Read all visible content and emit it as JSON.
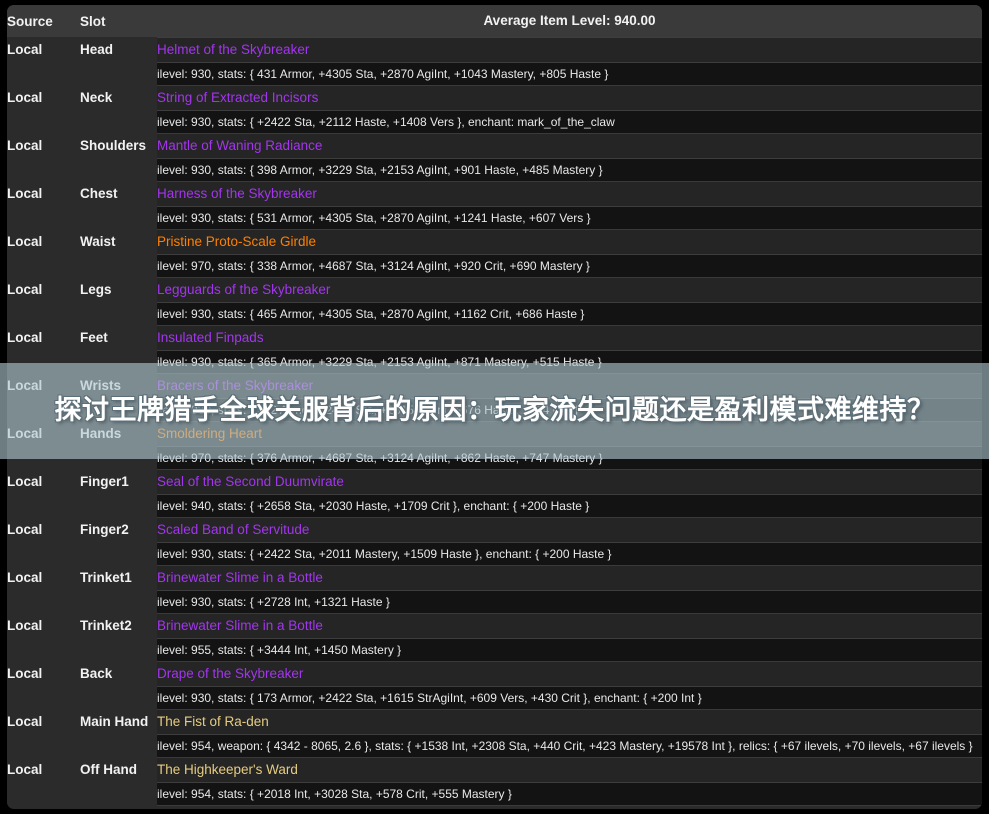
{
  "header": {
    "source_label": "Source",
    "slot_label": "Slot",
    "average_item_level": "Average Item Level: 940.00"
  },
  "colors": {
    "epic": "#a335ee",
    "legendary": "#ff8000",
    "artifact": "#e6cc80",
    "panel_bg": "#2b2b2b",
    "stat_bg": "#131313",
    "header_bg": "#3a3a3a",
    "overlay_bg": "rgba(176,200,208,0.62)"
  },
  "overlay": {
    "text": "探讨王牌猎手全球关服背后的原因：玩家流失问题还是盈利模式难维持？"
  },
  "rows": [
    {
      "source": "Local",
      "slot": "Head",
      "item": "Helmet of the Skybreaker",
      "quality": "epic",
      "stats": "ilevel: 930, stats: { 431 Armor, +4305 Sta, +2870 AgiInt, +1043 Mastery, +805 Haste }"
    },
    {
      "source": "Local",
      "slot": "Neck",
      "item": "String of Extracted Incisors",
      "quality": "epic",
      "stats": "ilevel: 930, stats: { +2422 Sta, +2112 Haste, +1408 Vers }, enchant: mark_of_the_claw"
    },
    {
      "source": "Local",
      "slot": "Shoulders",
      "item": "Mantle of Waning Radiance",
      "quality": "epic",
      "stats": "ilevel: 930, stats: { 398 Armor, +3229 Sta, +2153 AgiInt, +901 Haste, +485 Mastery }"
    },
    {
      "source": "Local",
      "slot": "Chest",
      "item": "Harness of the Skybreaker",
      "quality": "epic",
      "stats": "ilevel: 930, stats: { 531 Armor, +4305 Sta, +2870 AgiInt, +1241 Haste, +607 Vers }"
    },
    {
      "source": "Local",
      "slot": "Waist",
      "item": "Pristine Proto-Scale Girdle",
      "quality": "legendary",
      "stats": "ilevel: 970, stats: { 338 Armor, +4687 Sta, +3124 AgiInt, +920 Crit, +690 Mastery }"
    },
    {
      "source": "Local",
      "slot": "Legs",
      "item": "Legguards of the Skybreaker",
      "quality": "epic",
      "stats": "ilevel: 930, stats: { 465 Armor, +4305 Sta, +2870 AgiInt, +1162 Crit, +686 Haste }"
    },
    {
      "source": "Local",
      "slot": "Feet",
      "item": "Insulated Finpads",
      "quality": "epic",
      "stats": "ilevel: 930, stats: { 365 Armor, +3229 Sta, +2153 AgiInt, +871 Mastery, +515 Haste }"
    },
    {
      "source": "Local",
      "slot": "Wrists",
      "item": "Bracers of the Skybreaker",
      "quality": "epic",
      "stats": "ilevel: 930, stats: { 232 Armor, +2422 Sta, +1615 AgiInt, +676 Haste, +364 Crit }"
    },
    {
      "source": "Local",
      "slot": "Hands",
      "item": "Smoldering Heart",
      "quality": "legendary",
      "stats": "ilevel: 970, stats: { 376 Armor, +4687 Sta, +3124 AgiInt, +862 Haste, +747 Mastery }"
    },
    {
      "source": "Local",
      "slot": "Finger1",
      "item": "Seal of the Second Duumvirate",
      "quality": "epic",
      "stats": "ilevel: 940, stats: { +2658 Sta, +2030 Haste, +1709 Crit }, enchant: { +200 Haste }"
    },
    {
      "source": "Local",
      "slot": "Finger2",
      "item": "Scaled Band of Servitude",
      "quality": "epic",
      "stats": "ilevel: 930, stats: { +2422 Sta, +2011 Mastery, +1509 Haste }, enchant: { +200 Haste }"
    },
    {
      "source": "Local",
      "slot": "Trinket1",
      "item": "Brinewater Slime in a Bottle",
      "quality": "epic",
      "stats": "ilevel: 930, stats: { +2728 Int, +1321 Haste }"
    },
    {
      "source": "Local",
      "slot": "Trinket2",
      "item": "Brinewater Slime in a Bottle",
      "quality": "epic",
      "stats": "ilevel: 955, stats: { +3444 Int, +1450 Mastery }"
    },
    {
      "source": "Local",
      "slot": "Back",
      "item": "Drape of the Skybreaker",
      "quality": "epic",
      "stats": "ilevel: 930, stats: { 173 Armor, +2422 Sta, +1615 StrAgiInt, +609 Vers, +430 Crit }, enchant: { +200 Int }"
    },
    {
      "source": "Local",
      "slot": "Main Hand",
      "item": "The Fist of Ra-den",
      "quality": "artifact",
      "stats": "ilevel: 954, weapon: { 4342 - 8065, 2.6 }, stats: { +1538 Int, +2308 Sta, +440 Crit, +423 Mastery, +19578 Int }, relics: { +67 ilevels, +70 ilevels, +67 ilevels }"
    },
    {
      "source": "Local",
      "slot": "Off Hand",
      "item": "The Highkeeper's Ward",
      "quality": "artifact",
      "stats": "ilevel: 954, stats: { +2018 Int, +3028 Sta, +578 Crit, +555 Mastery }"
    }
  ]
}
